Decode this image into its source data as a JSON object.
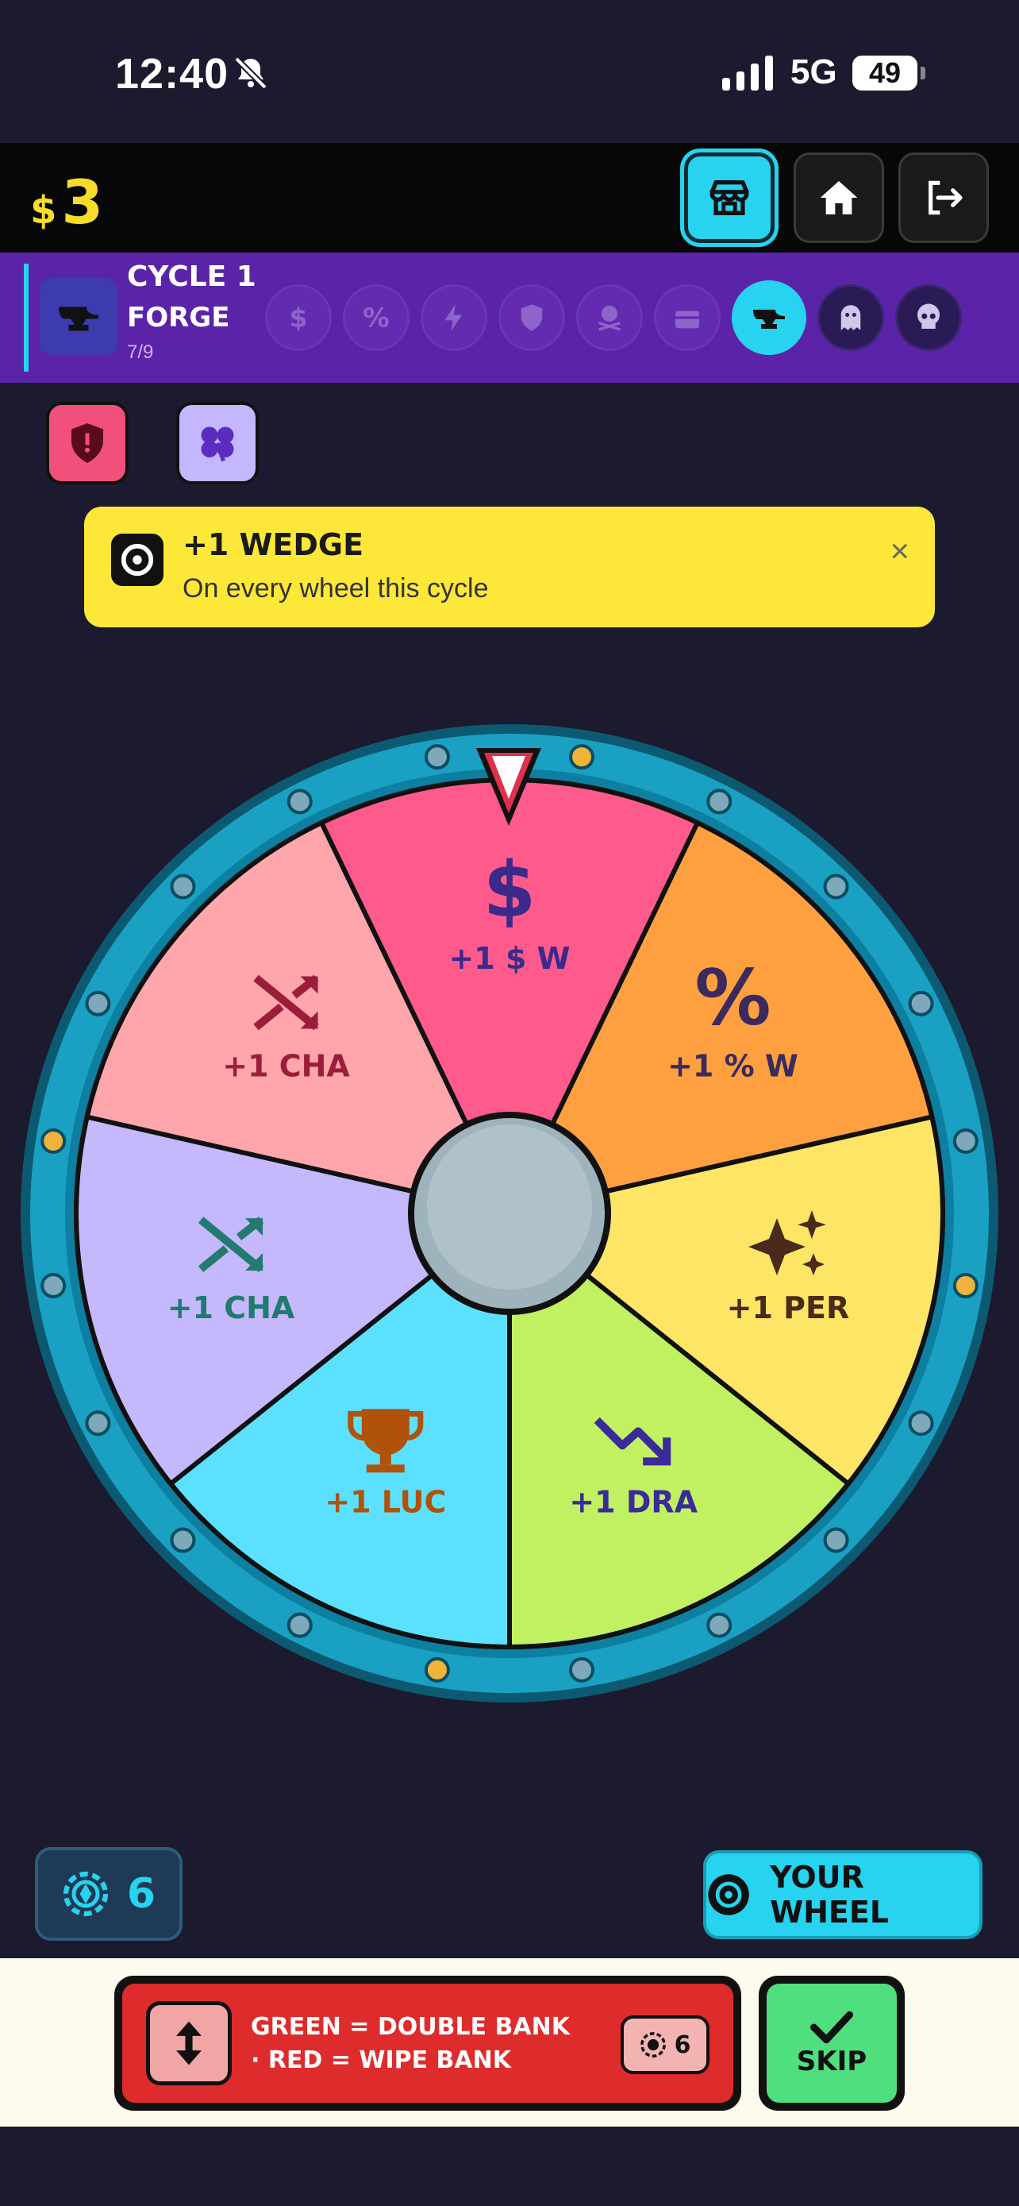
{
  "status_bar": {
    "time": "12:40",
    "network": "5G",
    "battery": "49"
  },
  "header": {
    "currency_symbol": "$",
    "balance": "3"
  },
  "cycle": {
    "title": "CYCLE 1",
    "stage": "FORGE",
    "progress": "7/9",
    "nodes": [
      {
        "icon": "dollar-icon",
        "state": "done"
      },
      {
        "icon": "percent-icon",
        "state": "done"
      },
      {
        "icon": "bolt-icon",
        "state": "done"
      },
      {
        "icon": "shield-icon",
        "state": "done"
      },
      {
        "icon": "skull-crossbones-icon",
        "state": "done"
      },
      {
        "icon": "chest-icon",
        "state": "done"
      },
      {
        "icon": "anvil-icon",
        "state": "active"
      },
      {
        "icon": "ghost-icon",
        "state": "future"
      },
      {
        "icon": "skull-icon",
        "state": "future"
      }
    ]
  },
  "perks": [
    {
      "icon": "shield-icon"
    },
    {
      "icon": "clover-icon"
    }
  ],
  "toast": {
    "title": "+1 WEDGE",
    "subtitle": "On every wheel this cycle",
    "close": "×"
  },
  "wheel": {
    "segments": [
      {
        "label": "+1 $ W",
        "icon": "dollar-icon",
        "color": "#ff5a8c"
      },
      {
        "label": "+1 % W",
        "icon": "percent-icon",
        "color": "#ffa040"
      },
      {
        "label": "+1 PER",
        "icon": "sparkles-icon",
        "color": "#ffe566"
      },
      {
        "label": "+1 DRA",
        "icon": "trend-down-icon",
        "color": "#c1f060"
      },
      {
        "label": "+1 LUC",
        "icon": "trophy-icon",
        "color": "#5ce0ff"
      },
      {
        "label": "+1 CHA",
        "icon": "shuffle-icon",
        "color": "#c5b8fd"
      },
      {
        "label": "+1 CHA",
        "icon": "shuffle-icon",
        "color": "#ffa6ac"
      }
    ]
  },
  "controls": {
    "chips": "6",
    "your_wheel": "YOUR WHEEL",
    "bet_text": "GREEN = DOUBLE BANK · RED = WIPE BANK",
    "bet_cost": "6",
    "skip": "SKIP"
  },
  "colors": {
    "background": "#1c1a2e",
    "cycle_bar": "#5b23a8",
    "accent": "#27d3ef",
    "money": "#f8dc2a",
    "toast": "#fde83a",
    "danger": "#de2b2b",
    "success": "#4fdf7e"
  }
}
